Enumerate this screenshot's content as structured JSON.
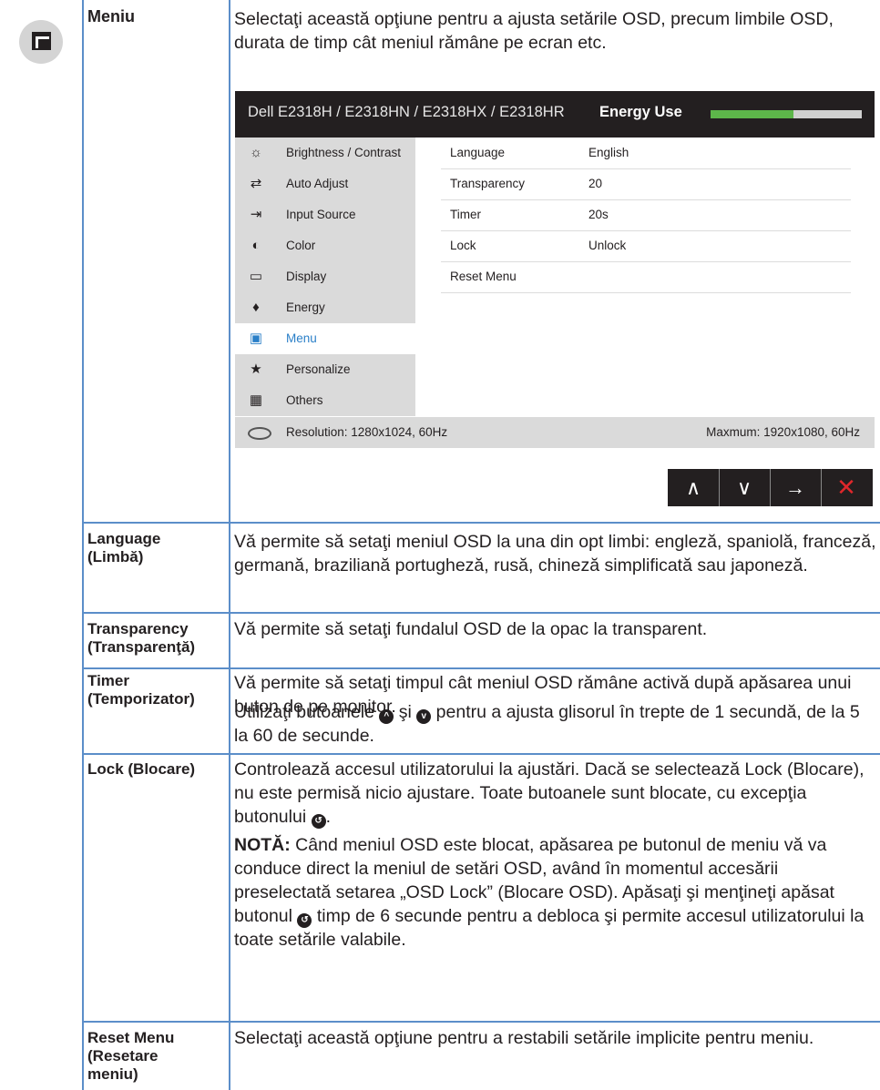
{
  "rows": [
    {
      "label": "Meniu",
      "desc": "Selectaţi această opţiune pentru a ajusta setările OSD, precum limbile OSD, durata de timp cât meniul rămâne pe ecran etc."
    },
    {
      "label_l1": "Language",
      "label_l2": "(Limbă)",
      "desc": "Vă permite să setaţi meniul OSD la una din opt limbi: engleză, spaniolă, franceză, germană, braziliană portugheză, rusă, chineză simplificată sau japoneză."
    },
    {
      "label_l1": "Transparency",
      "label_l2": "(Transparenţă)",
      "desc": "Vă permite să setaţi fundalul OSD de la opac la transparent."
    },
    {
      "label_l1": "Timer",
      "label_l2": "(Temporizator)",
      "desc": "Vă permite să setaţi timpul cât meniul OSD rămâne activă după apăsarea unui buton de pe monitor.",
      "desc2_a": "Utilizaţi butoanele ",
      "desc2_b": " şi ",
      "desc2_c": " pentru a ajusta glisorul în trepte de 1 secundă, de la 5 la 60 de secunde."
    },
    {
      "label": "Lock (Blocare)",
      "desc_a": "Controlează accesul utilizatorului la ajustări. Dacă se selectează Lock (Blocare), nu este permisă nicio ajustare. Toate butoanele sunt blocate, cu excepţia butonului ",
      "desc_b": ".",
      "note_label": "NOTĂ:",
      "note_a": " Când meniul OSD este blocat, apăsarea pe butonul de meniu vă va conduce direct la meniul de setări OSD, având în momentul accesării preselectată setarea „OSD Lock” (Blocare OSD). Apăsaţi şi menţineţi apăsat butonul ",
      "note_b": " timp de 6 secunde pentru a debloca şi permite accesul utilizatorului la toate setările valabile."
    },
    {
      "label_l1": "Reset Menu",
      "label_l2": "(Resetare",
      "label_l3": "meniu)",
      "desc": "Selectaţi această opţiune pentru a restabili setările implicite pentru meniu."
    }
  ],
  "osd": {
    "model": "Dell E2318H / E2318HN / E2318HX / E2318HR",
    "energy_label": "Energy Use",
    "energy_level": 0.55,
    "menu_items": [
      {
        "label": "Brightness / Contrast",
        "icon": "brightness-icon",
        "glyph": "☼"
      },
      {
        "label": "Auto Adjust",
        "icon": "auto-adjust-icon",
        "glyph": "⇄"
      },
      {
        "label": "Input Source",
        "icon": "input-source-icon",
        "glyph": "⇥"
      },
      {
        "label": "Color",
        "icon": "color-icon",
        "glyph": "◐"
      },
      {
        "label": "Display",
        "icon": "display-icon",
        "glyph": "▭"
      },
      {
        "label": "Energy",
        "icon": "energy-icon",
        "glyph": "♦"
      },
      {
        "label": "Menu",
        "icon": "menu-icon",
        "glyph": "▣"
      },
      {
        "label": "Personalize",
        "icon": "star-icon",
        "glyph": "★"
      },
      {
        "label": "Others",
        "icon": "others-icon",
        "glyph": "▦"
      }
    ],
    "active_index": 6,
    "settings": [
      {
        "key": "Language",
        "value": "English"
      },
      {
        "key": "Transparency",
        "value": "20"
      },
      {
        "key": "Timer",
        "value": "20s"
      },
      {
        "key": "Lock",
        "value": "Unlock"
      },
      {
        "key": "Reset Menu",
        "value": ""
      }
    ],
    "resolution": "Resolution: 1280x1024, 60Hz",
    "maximum": "Maxmum: 1920x1080, 60Hz",
    "buttons": [
      {
        "glyph": "∧",
        "icon": "up-icon"
      },
      {
        "glyph": "∨",
        "icon": "down-icon"
      },
      {
        "glyph": "→",
        "icon": "right-arrow-icon"
      },
      {
        "glyph": "✕",
        "icon": "close-icon"
      }
    ],
    "colors": {
      "header": "#231f20",
      "energy_fill": "#5db64a",
      "active": "#2a7fc8",
      "close": "#e0272b"
    }
  },
  "glyphs": {
    "up": "^",
    "down": "v",
    "back": "↺"
  }
}
